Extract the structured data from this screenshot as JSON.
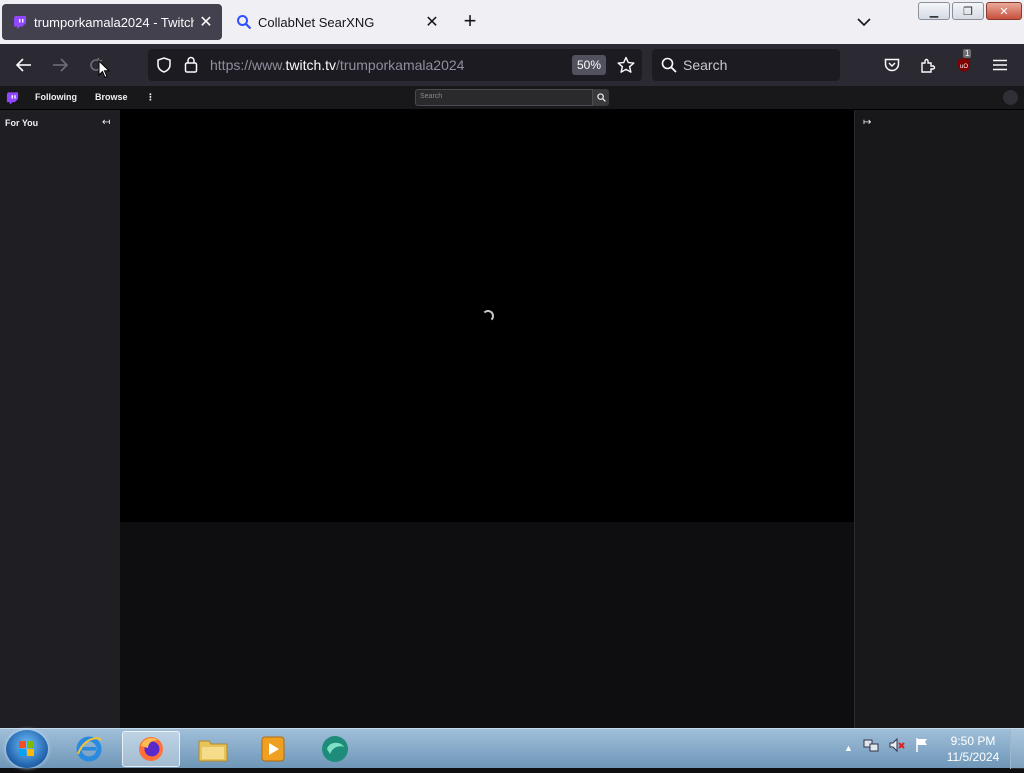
{
  "browser": {
    "tabs": [
      {
        "title": "trumporkamala2024 - Twitch",
        "active": true
      },
      {
        "title": "CollabNet SearXNG",
        "active": false
      }
    ],
    "new_tab_label": "+",
    "url_prefix": "https://www.",
    "url_host": "twitch.tv",
    "url_path": "/trumporkamala2024",
    "zoom": "50%",
    "search_placeholder": "Search",
    "extension_badge": "1"
  },
  "twitch": {
    "nav_following": "Following",
    "nav_browse": "Browse",
    "nav_more": "⋮",
    "search_placeholder": "Search",
    "sidebar_heading": "For You"
  },
  "taskbar": {
    "time": "9:50 PM",
    "date": "11/5/2024"
  },
  "colors": {
    "twitch_purple": "#9147ff",
    "browser_dark": "#2b2a33",
    "page_bg": "#0e0e10"
  }
}
